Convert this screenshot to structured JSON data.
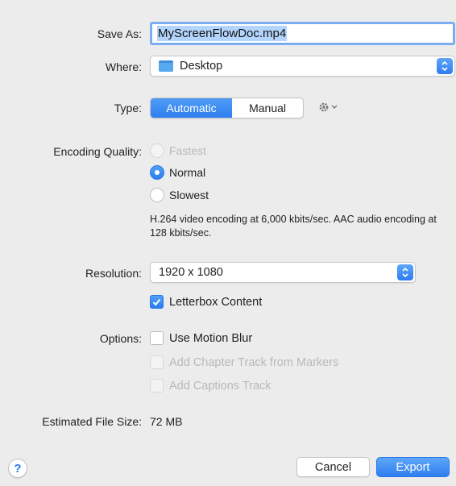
{
  "save_as": {
    "label": "Save As:",
    "value": "MyScreenFlowDoc.mp4"
  },
  "where": {
    "label": "Where:",
    "value": "Desktop",
    "icon": "folder-icon"
  },
  "type": {
    "label": "Type:",
    "segments": [
      "Automatic",
      "Manual"
    ],
    "selected": "Automatic"
  },
  "encoding_quality": {
    "label": "Encoding Quality:",
    "options": [
      {
        "label": "Fastest",
        "selected": false,
        "enabled": false
      },
      {
        "label": "Normal",
        "selected": true,
        "enabled": true
      },
      {
        "label": "Slowest",
        "selected": false,
        "enabled": true
      }
    ],
    "description": "H.264 video encoding at 6,000 kbits/sec.  AAC audio encoding at 128 kbits/sec."
  },
  "resolution": {
    "label": "Resolution:",
    "value": "1920 x 1080"
  },
  "letterbox": {
    "label": "Letterbox Content",
    "checked": true
  },
  "options": {
    "label": "Options:",
    "items": [
      {
        "label": "Use Motion Blur",
        "checked": false,
        "enabled": true
      },
      {
        "label": "Add Chapter Track from Markers",
        "checked": false,
        "enabled": false
      },
      {
        "label": "Add Captions Track",
        "checked": false,
        "enabled": false
      }
    ]
  },
  "estimated_size": {
    "label": "Estimated File Size:",
    "value": "72 MB"
  },
  "buttons": {
    "cancel": "Cancel",
    "export": "Export",
    "help": "?"
  },
  "colors": {
    "accent": "#2e7ef0",
    "background": "#ececec",
    "disabled_text": "#b9b9b9"
  }
}
